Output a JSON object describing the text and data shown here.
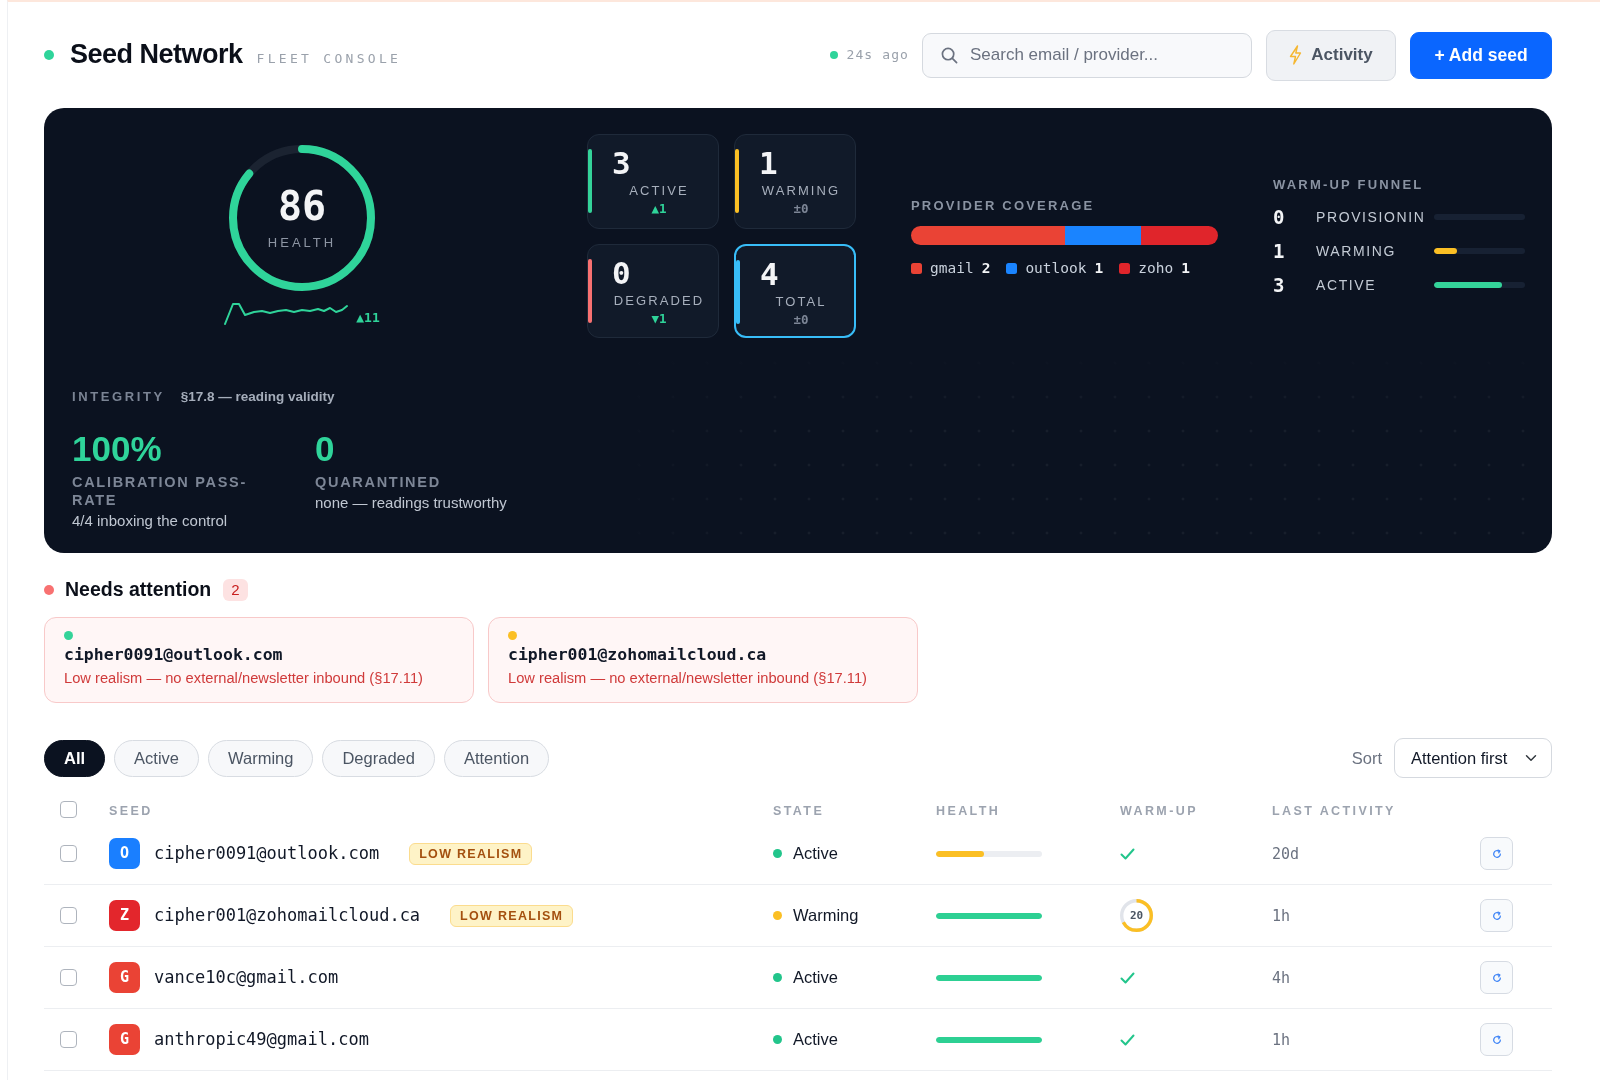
{
  "header": {
    "title": "Seed Network",
    "subtitle": "FLEET CONSOLE",
    "updated": "24s ago",
    "search": {
      "placeholder": "Search email / provider..."
    },
    "buttons": [
      {
        "kind": "activity",
        "label": "Activity"
      },
      {
        "kind": "add",
        "label": "+ Add seed"
      }
    ]
  },
  "overview": {
    "health": {
      "value": "86",
      "label": "HEALTH",
      "level": 0.86,
      "trend": "▲11"
    },
    "tiles": [
      {
        "value": "3",
        "label": "ACTIVE",
        "delta": {
          "text": "▲1",
          "color": "#2fd49a"
        },
        "color": "#34d399",
        "selected": false
      },
      {
        "value": "1",
        "label": "WARMING",
        "delta": {
          "text": "±0",
          "color": "#7d8696"
        },
        "color": "#fbbf24",
        "selected": false
      },
      {
        "value": "0",
        "label": "DEGRADED",
        "delta": {
          "text": "▼1",
          "color": "#2fd49a"
        },
        "color": "#f87171",
        "selected": false
      },
      {
        "value": "4",
        "label": "TOTAL",
        "delta": {
          "text": "±0",
          "color": "#7d8696"
        },
        "color": "#38bdf8",
        "selected": true
      }
    ],
    "provider_coverage": {
      "title": "PROVIDER COVERAGE",
      "providers": [
        {
          "name": "gmail",
          "count": "2",
          "color": "#ea4335"
        },
        {
          "name": "outlook",
          "count": "1",
          "color": "#1a84ff"
        },
        {
          "name": "zoho",
          "count": "1",
          "color": "#e0252b"
        }
      ]
    },
    "warmup_funnel": {
      "title": "WARM-UP FUNNEL",
      "stages": [
        {
          "count": "0",
          "label": "PROVISIONIN"
        },
        {
          "count": "1",
          "label": "WARMING",
          "level": 0.25,
          "color": "#fbbf24"
        },
        {
          "count": "3",
          "label": "ACTIVE",
          "level": 0.75,
          "color": "#34d399"
        }
      ]
    },
    "integrity": {
      "label": "INTEGRITY",
      "reference": "§17.8 — reading validity",
      "metrics": [
        {
          "value": "100%",
          "label": "CALIBRATION PASS-RATE",
          "note": "4/4 inboxing the control"
        },
        {
          "value": "0",
          "label": "QUARANTINED",
          "note": "none — readings trustworthy"
        }
      ]
    }
  },
  "attention": {
    "title": "Needs attention",
    "count": "2",
    "items": [
      {
        "email": "cipher0091@outlook.com",
        "reason": "Low realism — no external/newsletter inbound (§17.11)",
        "color": "#34d399"
      },
      {
        "email": "cipher001@zohomailcloud.ca",
        "reason": "Low realism — no external/newsletter inbound (§17.11)",
        "color": "#fbbf24"
      }
    ]
  },
  "filters": [
    {
      "label": "All",
      "selected": true
    },
    {
      "label": "Active",
      "selected": false
    },
    {
      "label": "Warming",
      "selected": false
    },
    {
      "label": "Degraded",
      "selected": false
    },
    {
      "label": "Attention",
      "selected": false
    }
  ],
  "sort": {
    "label": "Sort",
    "value": "Attention first"
  },
  "table": {
    "select_all_checked": false,
    "columns": [
      "SEED",
      "STATE",
      "HEALTH",
      "WARM-UP",
      "LAST ACTIVITY"
    ],
    "rows": [
      {
        "checked": false,
        "avatar": {
          "letter": "O",
          "color": "#1a7fff"
        },
        "email": "cipher0091@outlook.com",
        "badge": "LOW REALISM",
        "state": {
          "label": "Active",
          "color": "#22c58b"
        },
        "health": {
          "level": 0.45,
          "color": "#fbbf24"
        },
        "warmup": {
          "kind": "done"
        },
        "last_activity": "20d"
      },
      {
        "checked": false,
        "avatar": {
          "letter": "Z",
          "color": "#e3262c"
        },
        "email": "cipher001@zohomailcloud.ca",
        "badge": "LOW REALISM",
        "state": {
          "label": "Warming",
          "color": "#fbbf24"
        },
        "health": {
          "level": 1,
          "color": "#2dd093"
        },
        "warmup": {
          "kind": "ring",
          "label": "20",
          "level": 0.67
        },
        "last_activity": "1h"
      },
      {
        "checked": false,
        "avatar": {
          "letter": "G",
          "color": "#ea4335"
        },
        "email": "vance10c@gmail.com",
        "state": {
          "label": "Active",
          "color": "#22c58b"
        },
        "health": {
          "level": 1,
          "color": "#2dd093"
        },
        "warmup": {
          "kind": "done"
        },
        "last_activity": "4h"
      },
      {
        "checked": false,
        "avatar": {
          "letter": "G",
          "color": "#ea4335"
        },
        "email": "anthropic49@gmail.com",
        "state": {
          "label": "Active",
          "color": "#22c58b"
        },
        "health": {
          "level": 1,
          "color": "#2dd093"
        },
        "warmup": {
          "kind": "done"
        },
        "last_activity": "1h"
      }
    ]
  }
}
